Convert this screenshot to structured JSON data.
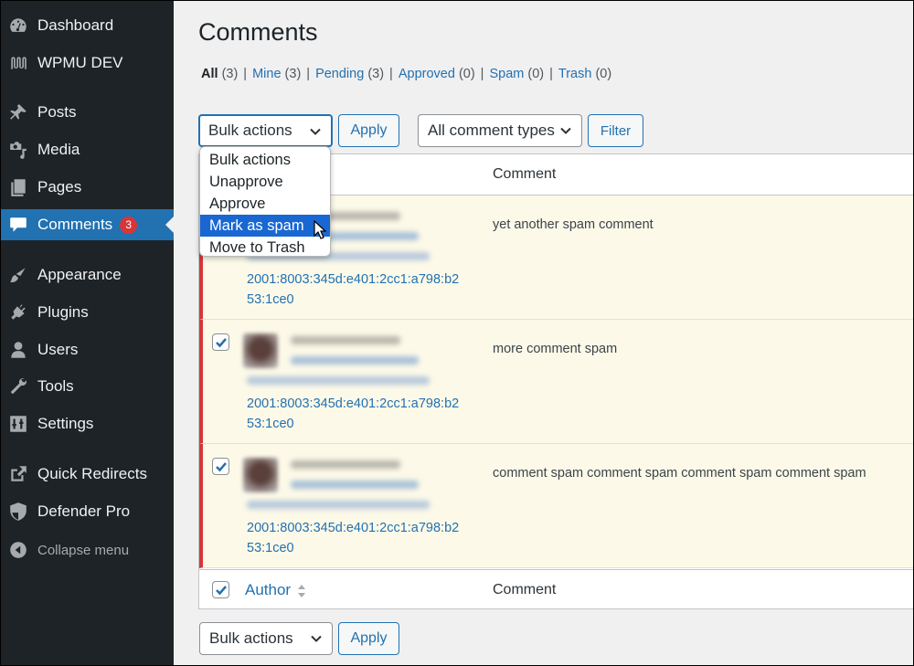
{
  "sidebar": {
    "items": [
      {
        "label": "Dashboard",
        "icon": "dashboard-icon"
      },
      {
        "label": "WPMU DEV",
        "icon": "wpmudev-icon"
      },
      {
        "label": "Posts",
        "icon": "pin-icon"
      },
      {
        "label": "Media",
        "icon": "media-icon"
      },
      {
        "label": "Pages",
        "icon": "pages-icon"
      },
      {
        "label": "Comments",
        "icon": "comment-icon",
        "badge": "3",
        "active": true
      },
      {
        "label": "Appearance",
        "icon": "paintbrush-icon"
      },
      {
        "label": "Plugins",
        "icon": "plugin-icon"
      },
      {
        "label": "Users",
        "icon": "user-icon"
      },
      {
        "label": "Tools",
        "icon": "wrench-icon"
      },
      {
        "label": "Settings",
        "icon": "settings-icon"
      },
      {
        "label": "Quick Redirects",
        "icon": "external-link-icon"
      },
      {
        "label": "Defender Pro",
        "icon": "shield-icon"
      },
      {
        "label": "Collapse menu",
        "icon": "collapse-icon"
      }
    ]
  },
  "page": {
    "title": "Comments"
  },
  "filters": {
    "all": {
      "label": "All",
      "count": "(3)"
    },
    "mine": {
      "label": "Mine",
      "count": "(3)"
    },
    "pending": {
      "label": "Pending",
      "count": "(3)"
    },
    "approved": {
      "label": "Approved",
      "count": "(0)"
    },
    "spam": {
      "label": "Spam",
      "count": "(0)"
    },
    "trash": {
      "label": "Trash",
      "count": "(0)"
    },
    "separator": "|"
  },
  "toolbar": {
    "bulk_actions_value": "Bulk actions",
    "apply_label": "Apply",
    "comment_types_value": "All comment types",
    "filter_label": "Filter"
  },
  "bulk_dropdown": {
    "options": [
      "Bulk actions",
      "Unapprove",
      "Approve",
      "Mark as spam",
      "Move to Trash"
    ],
    "highlighted": "Mark as spam"
  },
  "table": {
    "header_comment": "Comment",
    "footer_author": "Author",
    "footer_comment": "Comment",
    "rows": [
      {
        "checked": true,
        "ip_line1": "2001:8003:345d:e401:2cc1:a798:b2",
        "ip_line2": "53:1ce0",
        "comment": "yet another spam comment"
      },
      {
        "checked": true,
        "ip_line1": "2001:8003:345d:e401:2cc1:a798:b2",
        "ip_line2": "53:1ce0",
        "comment": "more comment spam"
      },
      {
        "checked": true,
        "ip_line1": "2001:8003:345d:e401:2cc1:a798:b2",
        "ip_line2": "53:1ce0",
        "comment": "comment spam comment spam comment spam comment spam"
      }
    ]
  },
  "bottom_toolbar": {
    "bulk_actions_value": "Bulk actions",
    "apply_label": "Apply"
  },
  "colors": {
    "accent": "#2271b1",
    "sidebar_bg": "#1d2327",
    "badge": "#d63638",
    "unapproved_row": "#fcf9e8",
    "dropdown_highlight": "#1967d2"
  }
}
